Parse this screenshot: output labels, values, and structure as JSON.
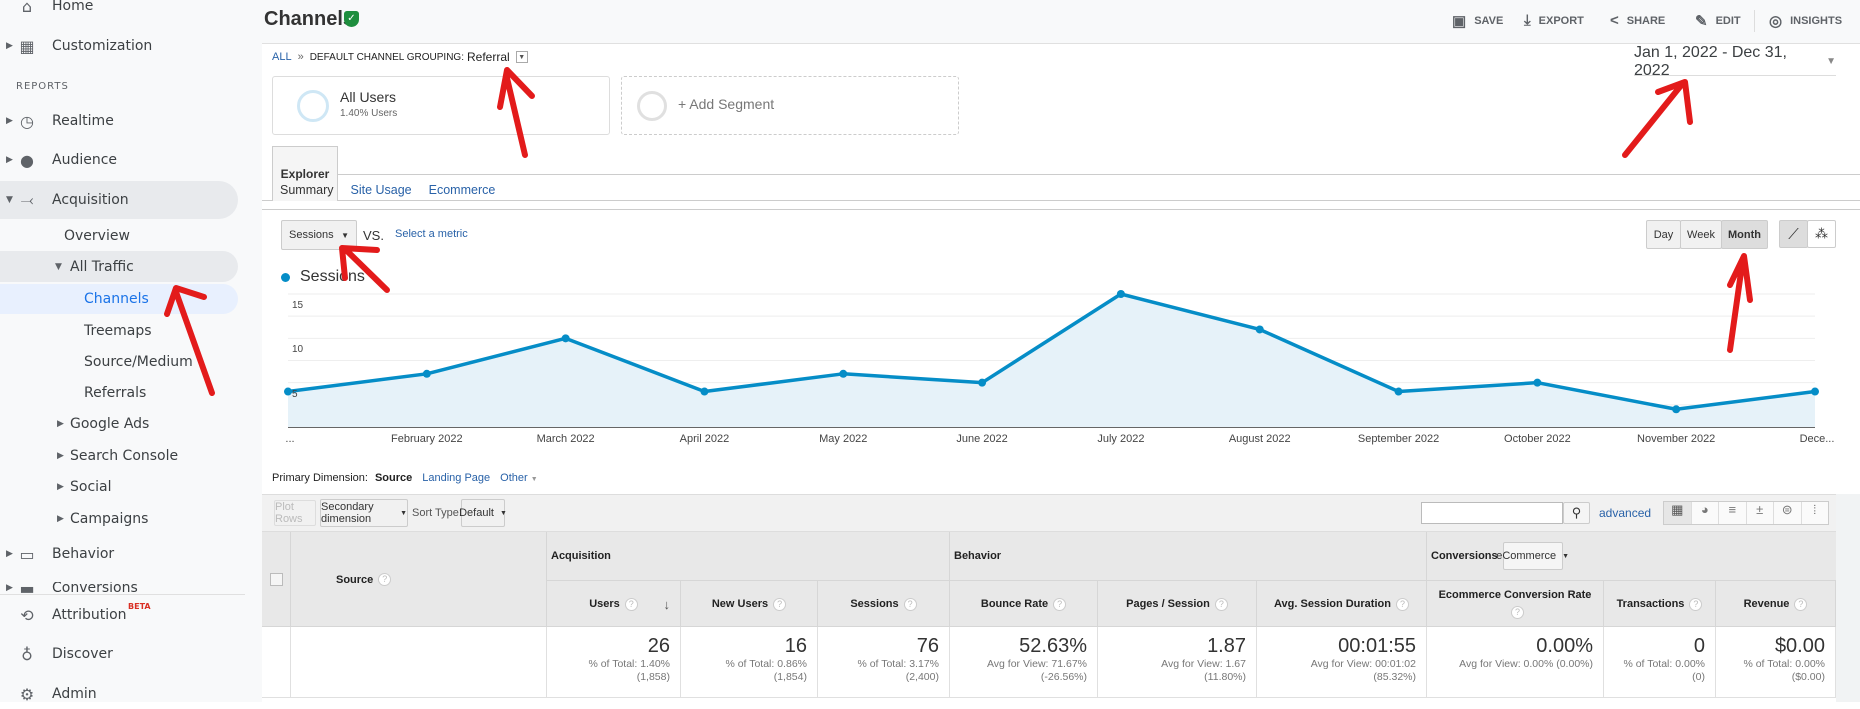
{
  "sidebar": {
    "home": "Home",
    "customization": "Customization",
    "reports_heading": "REPORTS",
    "realtime": "Realtime",
    "audience": "Audience",
    "acquisition": "Acquisition",
    "overview": "Overview",
    "all_traffic": "All Traffic",
    "channels": "Channels",
    "treemaps": "Treemaps",
    "source_medium": "Source/Medium",
    "referrals": "Referrals",
    "google_ads": "Google Ads",
    "search_console": "Search Console",
    "social": "Social",
    "campaigns": "Campaigns",
    "behavior": "Behavior",
    "conversions": "Conversions",
    "attribution": "Attribution",
    "beta_badge": "BETA",
    "discover": "Discover",
    "admin": "Admin"
  },
  "header": {
    "title": "Channels",
    "save": "SAVE",
    "export": "EXPORT",
    "share": "SHARE",
    "edit": "EDIT",
    "insights": "INSIGHTS"
  },
  "breadcrumb": {
    "all": "ALL",
    "separator": "»",
    "grouping": "DEFAULT CHANNEL GROUPING:",
    "value": "Referral"
  },
  "date_range": "Jan 1, 2022 - Dec 31, 2022",
  "segments": {
    "name": "All Users",
    "detail": "1.40% Users",
    "add": "+ Add Segment"
  },
  "tabs": {
    "explorer": "Explorer",
    "summary": "Summary",
    "site_usage": "Site Usage",
    "ecommerce": "Ecommerce"
  },
  "chart_controls": {
    "metric": "Sessions",
    "vs": "VS.",
    "select_metric": "Select a metric",
    "day": "Day",
    "week": "Week",
    "month": "Month",
    "selected_interval": "Month"
  },
  "chart_data": {
    "type": "area",
    "legend": "Sessions",
    "series_color": "#058dc7",
    "categories": [
      "...",
      "February 2022",
      "March 2022",
      "April 2022",
      "May 2022",
      "June 2022",
      "July 2022",
      "August 2022",
      "September 2022",
      "October 2022",
      "November 2022",
      "Dece..."
    ],
    "series": [
      {
        "name": "Sessions",
        "values": [
          4,
          6,
          10,
          4,
          6,
          5,
          15,
          11,
          4,
          5,
          2,
          4
        ]
      }
    ],
    "yticks": [
      "5",
      "10",
      "15"
    ],
    "ylim": [
      0,
      15
    ],
    "grid": true
  },
  "table_controls": {
    "primary_label": "Primary Dimension:",
    "source": "Source",
    "landing_page": "Landing Page",
    "other": "Other",
    "plot_rows": "Plot Rows",
    "secondary": "Secondary dimension",
    "sort_type": "Sort Type:",
    "sort_value": "Default",
    "search_placeholder": "",
    "advanced": "advanced"
  },
  "table": {
    "group_acquisition": "Acquisition",
    "group_behavior": "Behavior",
    "group_conversions": "Conversions",
    "conversions_select": "eCommerce",
    "source_header": "Source",
    "columns": [
      "Users",
      "New Users",
      "Sessions",
      "Bounce Rate",
      "Pages / Session",
      "Avg. Session Duration",
      "Ecommerce Conversion Rate",
      "Transactions",
      "Revenue"
    ],
    "totals": [
      {
        "value": "26",
        "sub1": "% of Total: 1.40%",
        "sub2": "(1,858)"
      },
      {
        "value": "16",
        "sub1": "% of Total: 0.86%",
        "sub2": "(1,854)"
      },
      {
        "value": "76",
        "sub1": "% of Total: 3.17%",
        "sub2": "(2,400)"
      },
      {
        "value": "52.63%",
        "sub1": "Avg for View: 71.67%",
        "sub2": "(-26.56%)"
      },
      {
        "value": "1.87",
        "sub1": "Avg for View: 1.67",
        "sub2": "(11.80%)"
      },
      {
        "value": "00:01:55",
        "sub1": "Avg for View: 00:01:02",
        "sub2": "(85.32%)"
      },
      {
        "value": "0.00%",
        "sub1": "Avg for View: 0.00% (0.00%)",
        "sub2": ""
      },
      {
        "value": "0",
        "sub1": "% of Total: 0.00%",
        "sub2": "(0)"
      },
      {
        "value": "$0.00",
        "sub1": "% of Total: 0.00%",
        "sub2": "($0.00)"
      }
    ]
  },
  "colors": {
    "accent": "#1a73e8",
    "series": "#058dc7",
    "annotation": "#e31b1b",
    "verified": "#1e8e3e"
  }
}
